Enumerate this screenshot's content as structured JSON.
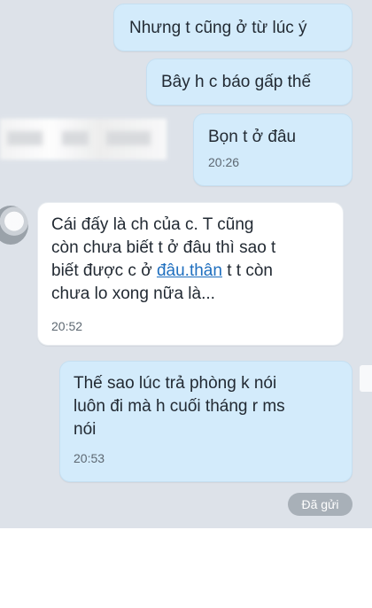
{
  "messages": [
    {
      "direction": "out",
      "text": "Nhưng t cũng ở từ lúc ý"
    },
    {
      "direction": "out",
      "text": "Bây h c báo gấp thế"
    },
    {
      "direction": "out",
      "text": "Bọn t ở đâu",
      "time": "20:26"
    },
    {
      "direction": "in",
      "lines": [
        "Cái đấy là ch của c. T cũng",
        "còn chưa biết t ở đâu thì sao t",
        "biết được c ở ",
        "chưa lo xong nữa là..."
      ],
      "link_text": "đâu.thân",
      "line3_tail": " t t còn",
      "time": "20:52"
    },
    {
      "direction": "out",
      "lines": [
        "Thế sao lúc trả phòng k nói",
        "luôn đi mà h cuối tháng r ms",
        "nói"
      ],
      "time": "20:53"
    }
  ],
  "status": {
    "sent_label": "Đã gửi"
  },
  "colors": {
    "chat_background": "#dde2e9",
    "outgoing_bubble": "#d3ebfb",
    "incoming_bubble": "#ffffff",
    "link": "#1f6fbf",
    "status_pill": "#a8b0b8"
  },
  "icons": {
    "avatar": "contact-avatar"
  }
}
